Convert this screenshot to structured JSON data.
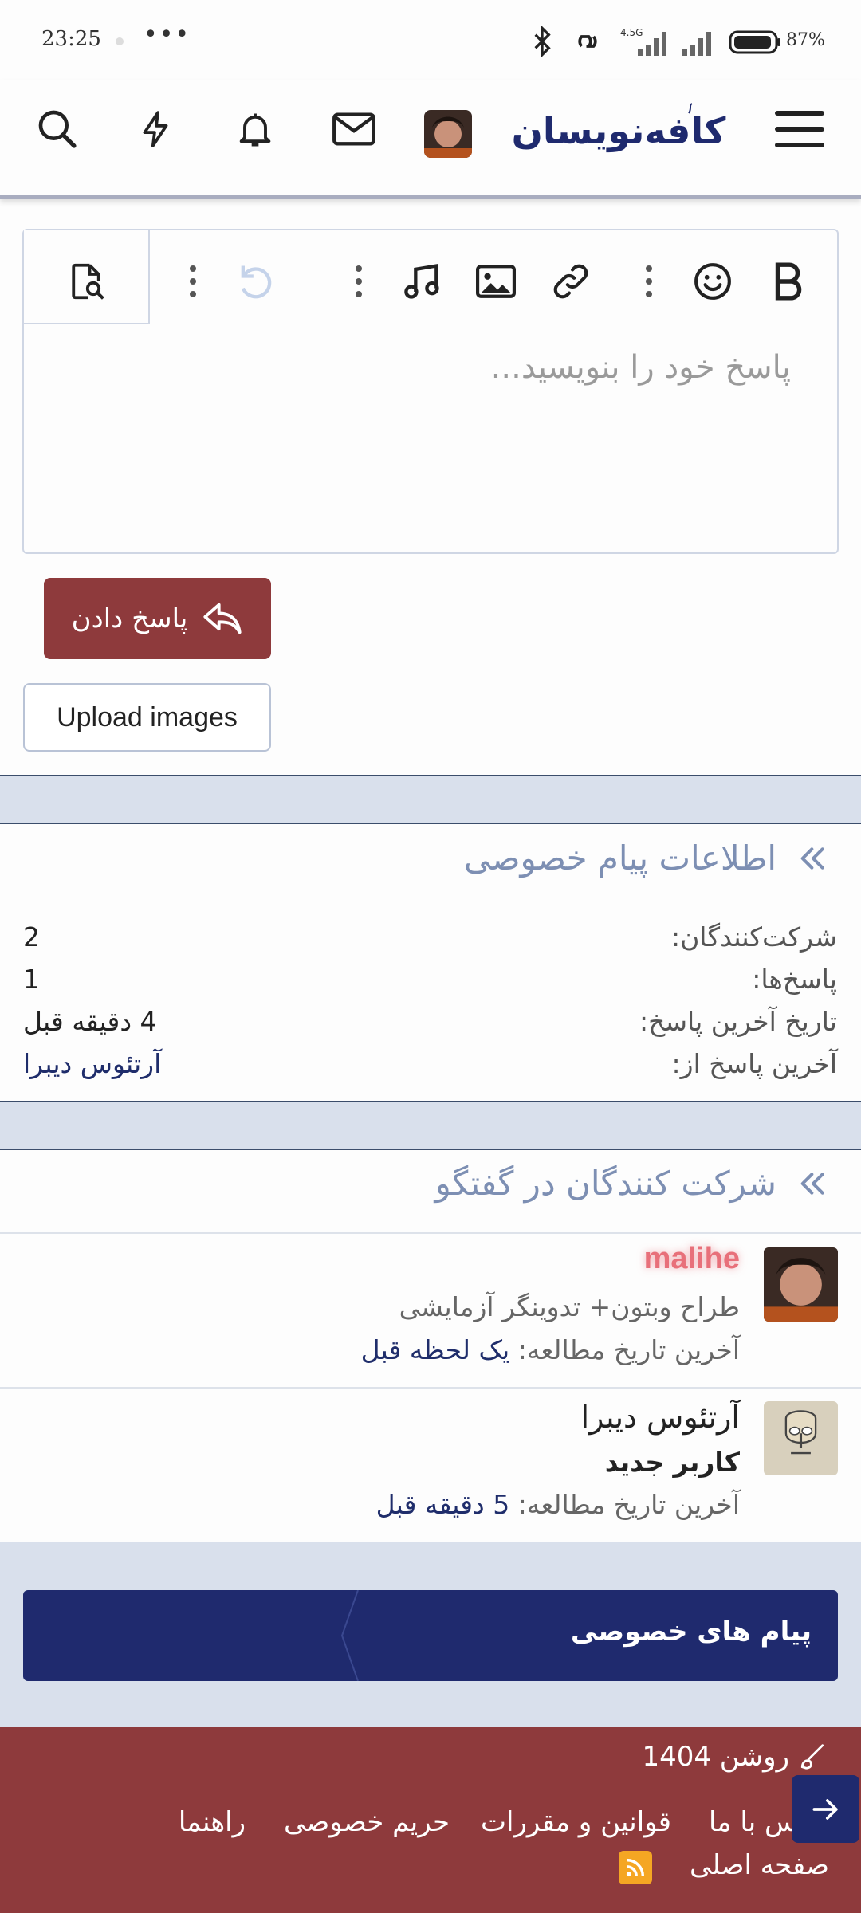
{
  "status_bar": {
    "time": "23:25",
    "dots": "•••",
    "network": "4.5G",
    "battery": "87%"
  },
  "header": {
    "logo_text": "کافه‌نویسان",
    "icons": [
      "search-icon",
      "bolt-icon",
      "bell-icon",
      "mail-icon",
      "user-avatar",
      "menu-icon"
    ]
  },
  "editor": {
    "placeholder": "پاسخ خود را بنویسید...",
    "toolbar": [
      "bold-icon",
      "emoji-icon",
      "more-icon",
      "link-icon",
      "image-icon",
      "music-icon",
      "more-icon",
      "undo-icon",
      "more-icon",
      "preview-icon"
    ]
  },
  "actions": {
    "reply_label": "پاسخ دادن",
    "upload_label": "Upload images"
  },
  "pm_info": {
    "title": "اطلاعات پیام خصوصی",
    "rows": [
      {
        "label": "شرکت‌کنندگان:",
        "value": "2"
      },
      {
        "label": "پاسخ‌ها:",
        "value": "1"
      },
      {
        "label": "تاریخ آخرین پاسخ:",
        "value": "4 دقیقه قبل"
      },
      {
        "label": "آخرین پاسخ از:",
        "value": "آرتئوس دیبرا"
      }
    ]
  },
  "participants": {
    "title": "شرکت کنندگان در گفتگو",
    "seen_label": "آخرین تاریخ مطالعه:",
    "items": [
      {
        "name": "malihe",
        "role": "طراح وبتون+ تدوینگر آزمایشی",
        "seen": "یک لحظه قبل",
        "name_color": "#e8707a"
      },
      {
        "name": "آرتئوس دیبرا",
        "role": "کاربر جدید",
        "seen": "5 دقیقه قبل",
        "name_color": "#222222"
      }
    ]
  },
  "breadcrumb": {
    "label": "پیام های خصوصی"
  },
  "footer": {
    "theme": "روشن 1404",
    "links": [
      "تماس با ما",
      "قوانین و مقررات",
      "حریم خصوصی",
      "راهنما"
    ],
    "home": "صفحه اصلی"
  },
  "colors": {
    "brand_navy": "#1f2a6e",
    "brand_red": "#8e3a3c",
    "accent_title": "#7d8fb3",
    "band": "#d9e0ec"
  }
}
